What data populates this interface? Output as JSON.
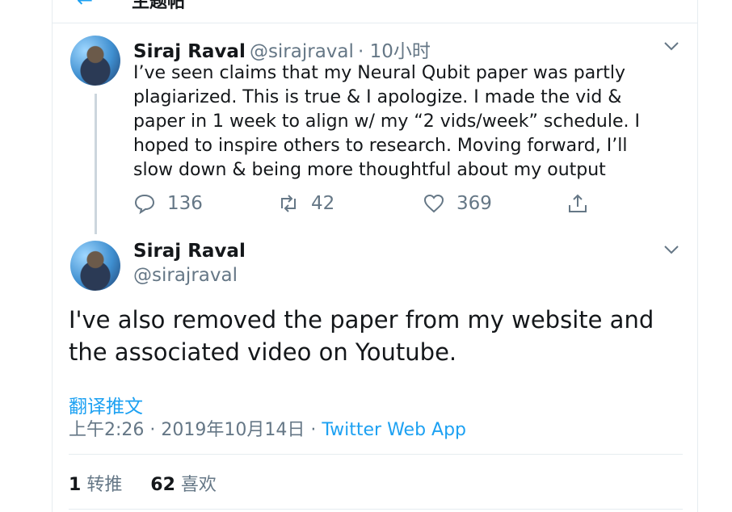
{
  "header": {
    "back_icon": "arrow-left-icon",
    "title": "主题帖"
  },
  "tweet1": {
    "name": "Siraj Raval",
    "handle": "@sirajraval",
    "time": "· 10小时",
    "text": "I’ve seen claims that my Neural Qubit paper was partly plagiarized. This is true & I apologize. I made the vid & paper in 1 week to align w/ my “2 vids/week” schedule. I hoped to inspire others to research. Moving forward, I’ll slow down & being more thoughtful about my output",
    "reply_count": "136",
    "retweet_count": "42",
    "like_count": "369"
  },
  "tweet2": {
    "name": "Siraj Raval",
    "handle": "@sirajraval",
    "text": "I've also removed the paper from my website and the associated video on Youtube.",
    "translate_label": "翻译推文",
    "timestamp": "上午2:26 · 2019年10月14日 · ",
    "source": "Twitter Web App",
    "retweets_num": "1",
    "retweets_label": "转推",
    "likes_num": "62",
    "likes_label": "喜欢"
  },
  "colors": {
    "accent": "#1da1f2",
    "muted": "#657786",
    "text": "#14171a",
    "border": "#e6ecf0"
  }
}
